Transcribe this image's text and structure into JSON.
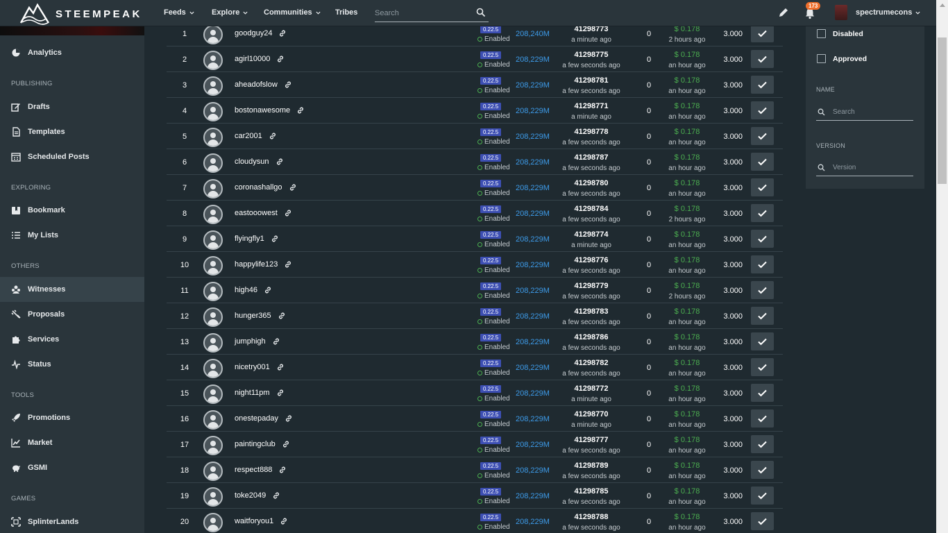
{
  "topnav": {
    "logo_text": "STEEMPEAK",
    "menu": [
      "Feeds",
      "Explore",
      "Communities",
      "Tribes"
    ],
    "search_placeholder": "Search",
    "notification_count": "173",
    "username": "spectrumecons"
  },
  "sidebar": {
    "items": [
      {
        "label": "Analytics",
        "icon": "analytics-icon"
      },
      {
        "label": "Drafts",
        "icon": "edit-icon"
      },
      {
        "label": "Templates",
        "icon": "document-icon"
      },
      {
        "label": "Scheduled Posts",
        "icon": "calendar-icon"
      },
      {
        "label": "Bookmark",
        "icon": "bookmark-icon"
      },
      {
        "label": "My Lists",
        "icon": "list-icon"
      },
      {
        "label": "Witnesses",
        "icon": "witnesses-icon"
      },
      {
        "label": "Proposals",
        "icon": "proposals-icon"
      },
      {
        "label": "Services",
        "icon": "puzzle-icon"
      },
      {
        "label": "Status",
        "icon": "pulse-icon"
      },
      {
        "label": "Promotions",
        "icon": "rocket-icon"
      },
      {
        "label": "Market",
        "icon": "chart-icon"
      },
      {
        "label": "GSMI",
        "icon": "piggy-bank-icon"
      },
      {
        "label": "SplinterLands",
        "icon": "splinterlands-icon"
      }
    ],
    "sections": [
      "PUBLISHING",
      "EXPLORING",
      "OTHERS",
      "TOOLS",
      "GAMES"
    ]
  },
  "witnesses": [
    {
      "rank": "1",
      "name": "goodguy24",
      "version": "0.22.5",
      "status": "Enabled",
      "votes": "208,240M",
      "block": "41298773",
      "block_time": "a minute ago",
      "missed": "0",
      "price": "$ 0.178",
      "price_time": "2 hours ago",
      "ratio": "3.000"
    },
    {
      "rank": "2",
      "name": "agirl10000",
      "version": "0.22.5",
      "status": "Enabled",
      "votes": "208,229M",
      "block": "41298775",
      "block_time": "a few seconds ago",
      "missed": "0",
      "price": "$ 0.178",
      "price_time": "an hour ago",
      "ratio": "3.000"
    },
    {
      "rank": "3",
      "name": "aheadofslow",
      "version": "0.22.5",
      "status": "Enabled",
      "votes": "208,229M",
      "block": "41298781",
      "block_time": "a few seconds ago",
      "missed": "0",
      "price": "$ 0.178",
      "price_time": "an hour ago",
      "ratio": "3.000"
    },
    {
      "rank": "4",
      "name": "bostonawesome",
      "version": "0.22.5",
      "status": "Enabled",
      "votes": "208,229M",
      "block": "41298771",
      "block_time": "a minute ago",
      "missed": "0",
      "price": "$ 0.178",
      "price_time": "an hour ago",
      "ratio": "3.000"
    },
    {
      "rank": "5",
      "name": "car2001",
      "version": "0.22.5",
      "status": "Enabled",
      "votes": "208,229M",
      "block": "41298778",
      "block_time": "a few seconds ago",
      "missed": "0",
      "price": "$ 0.178",
      "price_time": "an hour ago",
      "ratio": "3.000"
    },
    {
      "rank": "6",
      "name": "cloudysun",
      "version": "0.22.5",
      "status": "Enabled",
      "votes": "208,229M",
      "block": "41298787",
      "block_time": "a few seconds ago",
      "missed": "0",
      "price": "$ 0.178",
      "price_time": "an hour ago",
      "ratio": "3.000"
    },
    {
      "rank": "7",
      "name": "coronashallgo",
      "version": "0.22.5",
      "status": "Enabled",
      "votes": "208,229M",
      "block": "41298780",
      "block_time": "a few seconds ago",
      "missed": "0",
      "price": "$ 0.178",
      "price_time": "an hour ago",
      "ratio": "3.000"
    },
    {
      "rank": "8",
      "name": "eastooowest",
      "version": "0.22.5",
      "status": "Enabled",
      "votes": "208,229M",
      "block": "41298784",
      "block_time": "a few seconds ago",
      "missed": "0",
      "price": "$ 0.178",
      "price_time": "2 hours ago",
      "ratio": "3.000"
    },
    {
      "rank": "9",
      "name": "flyingfly1",
      "version": "0.22.5",
      "status": "Enabled",
      "votes": "208,229M",
      "block": "41298774",
      "block_time": "a minute ago",
      "missed": "0",
      "price": "$ 0.178",
      "price_time": "an hour ago",
      "ratio": "3.000"
    },
    {
      "rank": "10",
      "name": "happylife123",
      "version": "0.22.5",
      "status": "Enabled",
      "votes": "208,229M",
      "block": "41298776",
      "block_time": "a few seconds ago",
      "missed": "0",
      "price": "$ 0.178",
      "price_time": "an hour ago",
      "ratio": "3.000"
    },
    {
      "rank": "11",
      "name": "high46",
      "version": "0.22.5",
      "status": "Enabled",
      "votes": "208,229M",
      "block": "41298779",
      "block_time": "a few seconds ago",
      "missed": "0",
      "price": "$ 0.178",
      "price_time": "2 hours ago",
      "ratio": "3.000"
    },
    {
      "rank": "12",
      "name": "hunger365",
      "version": "0.22.5",
      "status": "Enabled",
      "votes": "208,229M",
      "block": "41298783",
      "block_time": "a few seconds ago",
      "missed": "0",
      "price": "$ 0.178",
      "price_time": "an hour ago",
      "ratio": "3.000"
    },
    {
      "rank": "13",
      "name": "jumphigh",
      "version": "0.22.5",
      "status": "Enabled",
      "votes": "208,229M",
      "block": "41298786",
      "block_time": "a few seconds ago",
      "missed": "0",
      "price": "$ 0.178",
      "price_time": "an hour ago",
      "ratio": "3.000"
    },
    {
      "rank": "14",
      "name": "nicetry001",
      "version": "0.22.5",
      "status": "Enabled",
      "votes": "208,229M",
      "block": "41298782",
      "block_time": "a few seconds ago",
      "missed": "0",
      "price": "$ 0.178",
      "price_time": "an hour ago",
      "ratio": "3.000"
    },
    {
      "rank": "15",
      "name": "night11pm",
      "version": "0.22.5",
      "status": "Enabled",
      "votes": "208,229M",
      "block": "41298772",
      "block_time": "a minute ago",
      "missed": "0",
      "price": "$ 0.178",
      "price_time": "an hour ago",
      "ratio": "3.000"
    },
    {
      "rank": "16",
      "name": "onestepaday",
      "version": "0.22.5",
      "status": "Enabled",
      "votes": "208,229M",
      "block": "41298770",
      "block_time": "a minute ago",
      "missed": "0",
      "price": "$ 0.178",
      "price_time": "an hour ago",
      "ratio": "3.000"
    },
    {
      "rank": "17",
      "name": "paintingclub",
      "version": "0.22.5",
      "status": "Enabled",
      "votes": "208,229M",
      "block": "41298777",
      "block_time": "a few seconds ago",
      "missed": "0",
      "price": "$ 0.178",
      "price_time": "an hour ago",
      "ratio": "3.000"
    },
    {
      "rank": "18",
      "name": "respect888",
      "version": "0.22.5",
      "status": "Enabled",
      "votes": "208,229M",
      "block": "41298789",
      "block_time": "a few seconds ago",
      "missed": "0",
      "price": "$ 0.178",
      "price_time": "an hour ago",
      "ratio": "3.000"
    },
    {
      "rank": "19",
      "name": "toke2049",
      "version": "0.22.5",
      "status": "Enabled",
      "votes": "208,229M",
      "block": "41298785",
      "block_time": "a few seconds ago",
      "missed": "0",
      "price": "$ 0.178",
      "price_time": "an hour ago",
      "ratio": "3.000"
    },
    {
      "rank": "20",
      "name": "waitforyou1",
      "version": "0.22.5",
      "status": "Enabled",
      "votes": "208,229M",
      "block": "41298788",
      "block_time": "a few seconds ago",
      "missed": "0",
      "price": "$ 0.178",
      "price_time": "an hour ago",
      "ratio": "3.000"
    }
  ],
  "filters": {
    "disabled_label": "Disabled",
    "approved_label": "Approved",
    "name_label": "NAME",
    "name_placeholder": "Search",
    "version_label": "VERSION",
    "version_placeholder": "Version"
  },
  "colors": {
    "background": "#1f2a30",
    "panel": "#2a353b",
    "votes_blue": "#3d9be9",
    "price_green": "#4caf50",
    "version_badge": "#3d4fb3",
    "notification_badge": "#ef6f2c"
  }
}
